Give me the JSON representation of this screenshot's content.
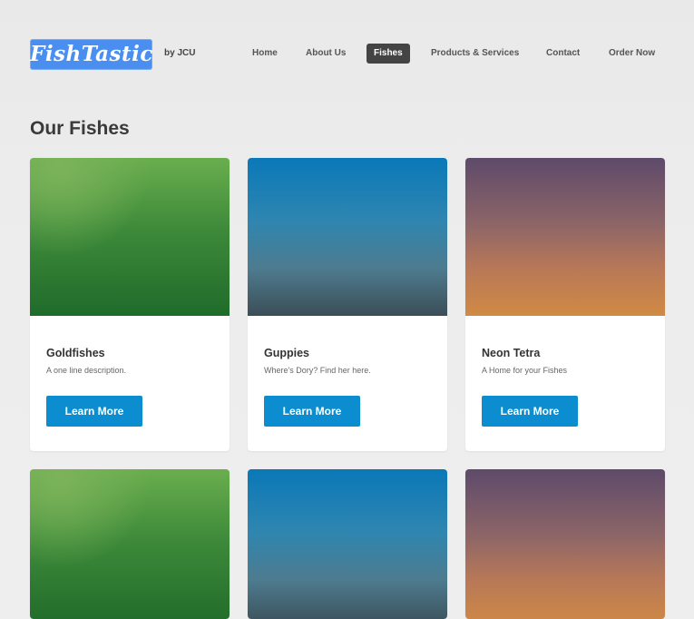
{
  "header": {
    "logo": "FishTastic",
    "byline": "by JCU",
    "nav": [
      {
        "label": "Home"
      },
      {
        "label": "About Us"
      },
      {
        "label": "Fishes",
        "active": true
      },
      {
        "label": "Products & Services"
      },
      {
        "label": "Contact"
      },
      {
        "label": "Order Now"
      }
    ]
  },
  "page": {
    "title": "Our Fishes"
  },
  "cards": [
    {
      "title": "Goldfishes",
      "description": "A one line description.",
      "button": "Learn More",
      "image": "green-gradient"
    },
    {
      "title": "Guppies",
      "description": "Where's Dory? Find her here.",
      "button": "Learn More",
      "image": "blue-gradient"
    },
    {
      "title": "Neon Tetra",
      "description": "A Home for your Fishes",
      "button": "Learn More",
      "image": "sunset-gradient"
    },
    {
      "image": "green-gradient"
    },
    {
      "image": "blue-gradient"
    },
    {
      "image": "sunset-gradient"
    }
  ],
  "colors": {
    "logo_bg": "#4a8ff0",
    "nav_active_bg": "#444444",
    "button_bg": "#0b8dcf",
    "page_bg": "#ececec"
  }
}
